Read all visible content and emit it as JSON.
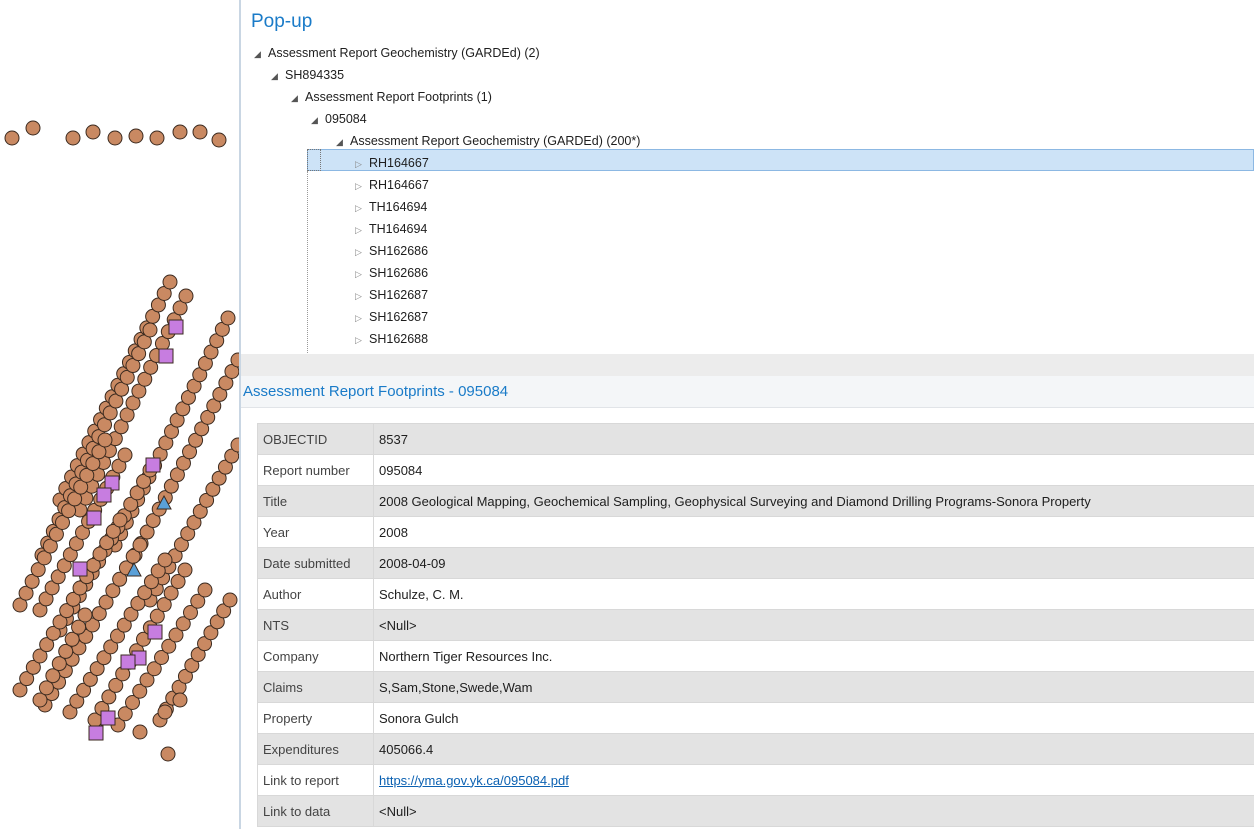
{
  "colors": {
    "accent": "#1a7bc8",
    "selection": "#cde3f7",
    "map_circle": "#c98962",
    "map_square": "#c77de0",
    "map_triangle": "#5aa0d8",
    "link": "#0b61b2"
  },
  "popup": {
    "title": "Pop-up",
    "tree": [
      {
        "label": "Assessment Report Geochemistry (GARDEd) (2)",
        "toggle": "◢",
        "state": "expanded"
      },
      {
        "label": "SH894335",
        "toggle": "◢",
        "state": "expanded"
      },
      {
        "label": "Assessment Report Footprints (1)",
        "toggle": "◢",
        "state": "expanded"
      },
      {
        "label": "095084",
        "toggle": "◢",
        "state": "expanded"
      },
      {
        "label": "Assessment Report Geochemistry (GARDEd) (200*)",
        "toggle": "◢",
        "state": "expanded"
      },
      {
        "label": "RH164667",
        "toggle": "▷",
        "state": "collapsed"
      },
      {
        "label": "RH164667",
        "toggle": "▷",
        "state": "collapsed"
      },
      {
        "label": "TH164694",
        "toggle": "▷",
        "state": "collapsed"
      },
      {
        "label": "TH164694",
        "toggle": "▷",
        "state": "collapsed"
      },
      {
        "label": "SH162686",
        "toggle": "▷",
        "state": "collapsed"
      },
      {
        "label": "SH162686",
        "toggle": "▷",
        "state": "collapsed"
      },
      {
        "label": "SH162687",
        "toggle": "▷",
        "state": "collapsed"
      },
      {
        "label": "SH162687",
        "toggle": "▷",
        "state": "collapsed"
      },
      {
        "label": "SH162688",
        "toggle": "▷",
        "state": "collapsed"
      }
    ],
    "detail_title": "Assessment Report Footprints - 095084",
    "attributes": [
      {
        "key": "OBJECTID",
        "value": "8537"
      },
      {
        "key": "Report number",
        "value": "095084"
      },
      {
        "key": "Title",
        "value": "2008 Geological Mapping, Geochemical Sampling, Geophysical Surveying and Diamond Drilling Programs-Sonora Property"
      },
      {
        "key": "Year",
        "value": "2008"
      },
      {
        "key": "Date submitted",
        "value": "2008-04-09"
      },
      {
        "key": "Author",
        "value": "Schulze, C. M."
      },
      {
        "key": "NTS",
        "value": "<Null>"
      },
      {
        "key": "Company",
        "value": "Northern Tiger Resources Inc."
      },
      {
        "key": "Claims",
        "value": "S,Sam,Stone,Swede,Wam"
      },
      {
        "key": "Property",
        "value": "Sonora Gulch"
      },
      {
        "key": "Expenditures",
        "value": "405066.4"
      },
      {
        "key": "Link to report",
        "value": "https://yma.gov.yk.ca/095084.pdf"
      },
      {
        "key": "Link to data",
        "value": "<Null>"
      }
    ]
  }
}
